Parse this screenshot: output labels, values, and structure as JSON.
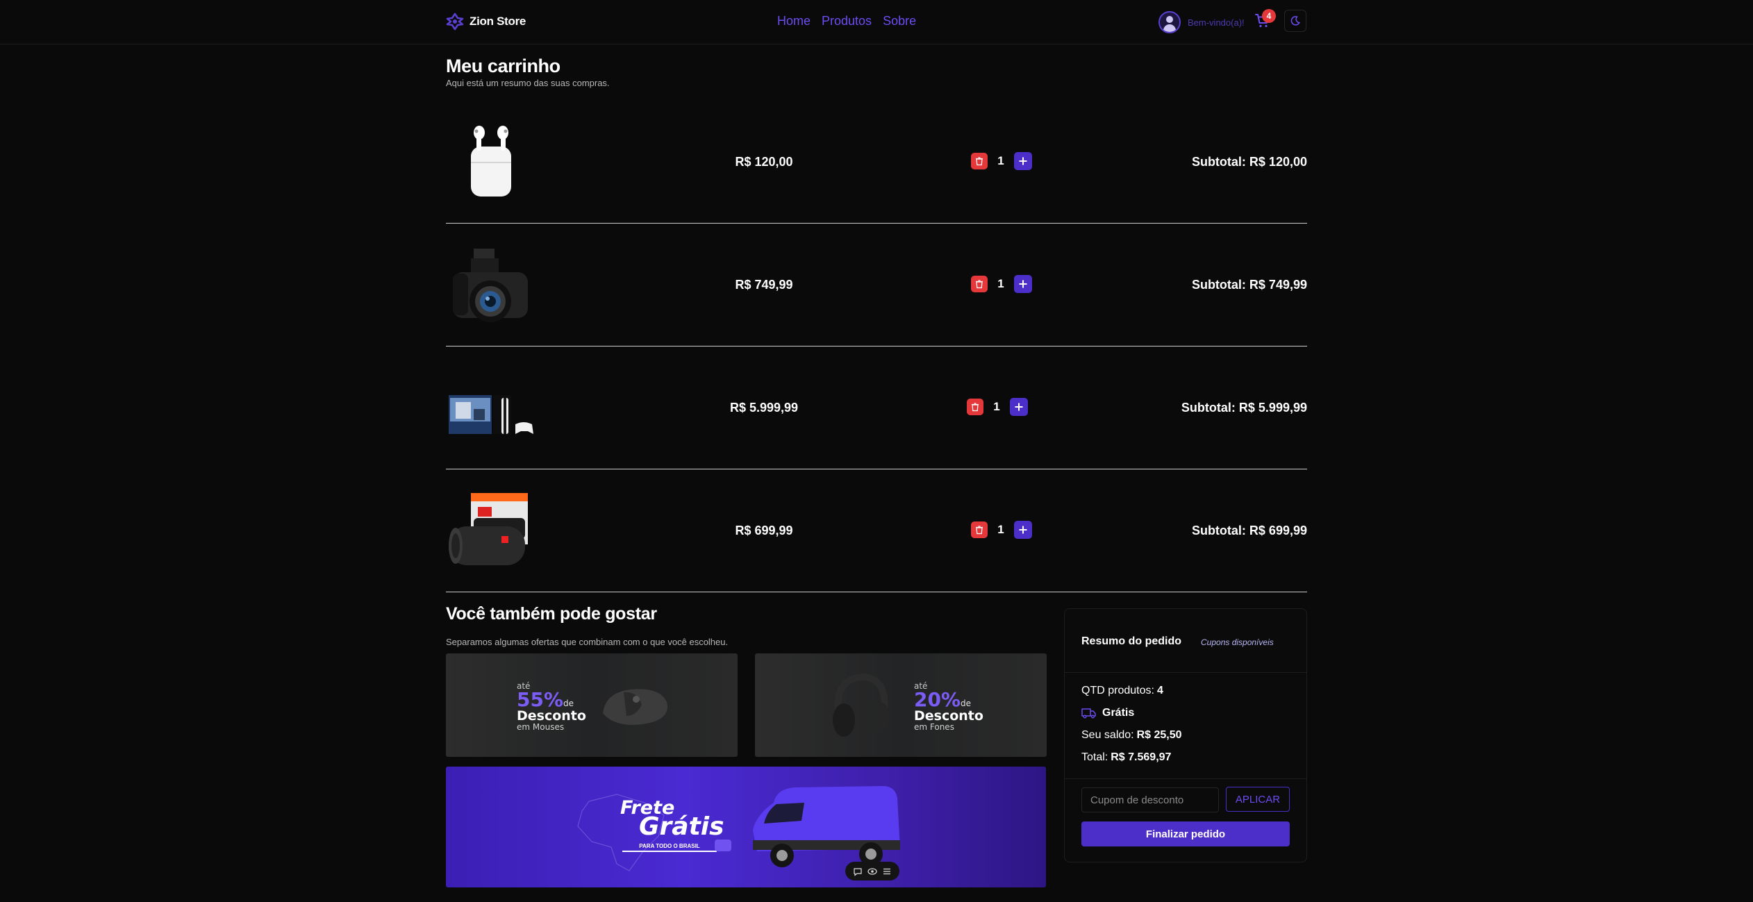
{
  "header": {
    "brand": "Zion Store",
    "nav": [
      {
        "label": "Home"
      },
      {
        "label": "Produtos"
      },
      {
        "label": "Sobre"
      }
    ],
    "welcome": "Bem-vindo(a)!",
    "cart_count": "4",
    "icons": [
      "logo-icon",
      "avatar",
      "cart-icon",
      "moon-icon"
    ]
  },
  "cart": {
    "title": "Meu carrinho",
    "subtitle": "Aqui está um resumo das suas compras.",
    "items": [
      {
        "product": "airpods",
        "price": "R$ 120,00",
        "qty": "1",
        "subtotal": "Subtotal: R$ 120,00"
      },
      {
        "product": "camera",
        "price": "R$ 749,99",
        "qty": "1",
        "subtotal": "Subtotal: R$ 749,99"
      },
      {
        "product": "console",
        "price": "R$ 5.999,99",
        "qty": "1",
        "subtotal": "Subtotal: R$ 5.999,99"
      },
      {
        "product": "speaker",
        "price": "R$ 699,99",
        "qty": "1",
        "subtotal": "Subtotal: R$ 699,99"
      }
    ]
  },
  "suggestions": {
    "title": "Você também pode gostar",
    "subtitle": "Separamos algumas ofertas que combinam com o que você escolheu.",
    "promos": [
      {
        "ate": "até",
        "pct": "55%",
        "de": "de",
        "desc": "Desconto",
        "cat": "em Mouses"
      },
      {
        "ate": "até",
        "pct": "20%",
        "de": "de",
        "desc": "Desconto",
        "cat": "em Fones"
      }
    ],
    "frete": {
      "line1": "Frete",
      "line2": "Grátis",
      "tag": "PARA TODO O BRASIL"
    }
  },
  "summary": {
    "title": "Resumo do pedido",
    "coupons_link": "Cupons disponíveis",
    "qty_label": "QTD produtos:",
    "qty_value": "4",
    "shipping": "Grátis",
    "balance_label": "Seu saldo:",
    "balance_value": "R$ 25,50",
    "total_label": "Total:",
    "total_value": "R$ 7.569,97",
    "coupon_placeholder": "Cupom de desconto",
    "apply_label": "APLICAR",
    "checkout_label": "Finalizar pedido"
  },
  "colors": {
    "background": "#0a0a0a",
    "accent": "#4c2fc9",
    "accent_text": "#6d4df2",
    "danger": "#e5383b"
  }
}
